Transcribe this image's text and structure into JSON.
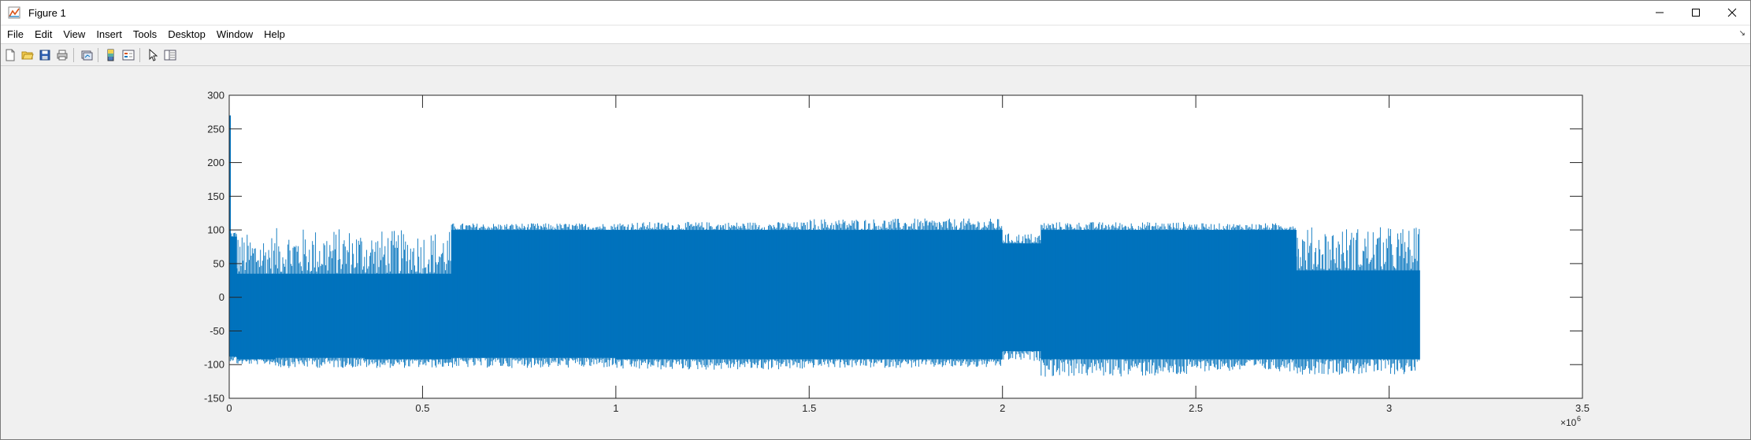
{
  "window": {
    "title": "Figure 1"
  },
  "menu": [
    "File",
    "Edit",
    "View",
    "Insert",
    "Tools",
    "Desktop",
    "Window",
    "Help"
  ],
  "toolbar": [
    "new-figure",
    "open-file",
    "save",
    "print",
    "link-plot",
    "insert-colorbar",
    "insert-legend",
    "edit-plot",
    "open-property-inspector"
  ],
  "colors": {
    "series": "#0072bd",
    "axes": "#262626",
    "background": "#f0f0f0"
  },
  "chart_data": {
    "type": "line",
    "title": "",
    "xlabel": "",
    "ylabel": "",
    "xlim": [
      0,
      3.5
    ],
    "ylim": [
      -150,
      300
    ],
    "x_exponent_label": "×10",
    "x_exponent_power": "6",
    "xticks": [
      0,
      0.5,
      1,
      1.5,
      2,
      2.5,
      3,
      3.5
    ],
    "xtick_labels": [
      "0",
      "0.5",
      "1",
      "1.5",
      "2",
      "2.5",
      "3",
      "3.5"
    ],
    "yticks": [
      -150,
      -100,
      -50,
      0,
      50,
      100,
      150,
      200,
      250,
      300
    ],
    "ytick_labels": [
      "-150",
      "-100",
      "-50",
      "0",
      "50",
      "100",
      "150",
      "200",
      "250",
      "300"
    ],
    "grid": false,
    "series": [
      {
        "segments": [
          {
            "x": [
              0,
              0.02
            ],
            "upper": 90,
            "lower": -88,
            "upper_max": 98,
            "lower_min": -95
          },
          {
            "x": [
              0.02,
              0.12
            ],
            "upper": 35,
            "lower": -92,
            "upper_max": 95,
            "lower_min": -100
          },
          {
            "x": [
              0.12,
              0.35
            ],
            "upper": 35,
            "lower": -90,
            "upper_max": 103,
            "lower_min": -105
          },
          {
            "x": [
              0.35,
              0.575
            ],
            "upper": 35,
            "lower": -92,
            "upper_max": 100,
            "lower_min": -105
          },
          {
            "x": [
              0.575,
              1.0
            ],
            "upper": 100,
            "lower": -90,
            "upper_max": 110,
            "lower_min": -105
          },
          {
            "x": [
              1.0,
              1.5
            ],
            "upper": 100,
            "lower": -92,
            "upper_max": 112,
            "lower_min": -108
          },
          {
            "x": [
              1.5,
              2.0
            ],
            "upper": 100,
            "lower": -92,
            "upper_max": 117,
            "lower_min": -105
          },
          {
            "x": [
              2.0,
              2.1
            ],
            "upper": 80,
            "lower": -80,
            "upper_max": 95,
            "lower_min": -95
          },
          {
            "x": [
              2.1,
              2.5
            ],
            "upper": 100,
            "lower": -92,
            "upper_max": 112,
            "lower_min": -118
          },
          {
            "x": [
              2.5,
              2.76
            ],
            "upper": 100,
            "lower": -92,
            "upper_max": 110,
            "lower_min": -110
          },
          {
            "x": [
              2.76,
              3.08
            ],
            "upper": 40,
            "lower": -92,
            "upper_max": 105,
            "lower_min": -115
          }
        ],
        "initial_spike": 270
      }
    ]
  }
}
